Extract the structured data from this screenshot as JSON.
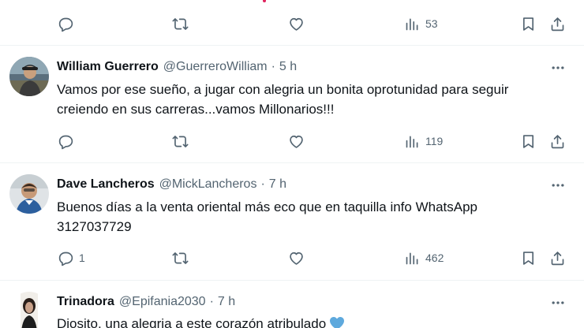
{
  "top_actions": {
    "reply_count": "",
    "repost_count": "",
    "like_count": "",
    "views": "53"
  },
  "tweets": [
    {
      "name": "William Guerrero",
      "handle": "@GuerreroWilliam",
      "sep": "·",
      "time": "5 h",
      "text_line1": "Vamos por ese sueño, a jugar con alegria un bonita oprotunidad para seguir",
      "text_line2": "creiendo en sus carreras...vamos Millonarios!!!",
      "reply_count": "",
      "repost_count": "",
      "like_count": "",
      "views": "119"
    },
    {
      "name": "Dave Lancheros",
      "handle": "@MickLancheros",
      "sep": "·",
      "time": "7 h",
      "text_line1": "Buenos días a la venta oriental más eco que en taquilla info WhatsApp",
      "text_line2": "3127037729",
      "reply_count": "1",
      "repost_count": "",
      "like_count": "",
      "views": "462"
    },
    {
      "name": "Trinadora",
      "handle": "@Epifania2030",
      "sep": "·",
      "time": "7 h",
      "text_line1": "Diosito, una alegria a este corazón atribulado",
      "text_line2": ""
    }
  ],
  "icons": {
    "reply": "reply-icon",
    "repost": "repost-icon",
    "like": "heart-icon",
    "views": "views-icon",
    "bookmark": "bookmark-icon",
    "share": "share-icon",
    "more": "more-icon"
  },
  "colors": {
    "text": "#0f1419",
    "muted": "#536471",
    "divider": "#eff3f4",
    "emoji_heart": "#5ea9dd"
  }
}
